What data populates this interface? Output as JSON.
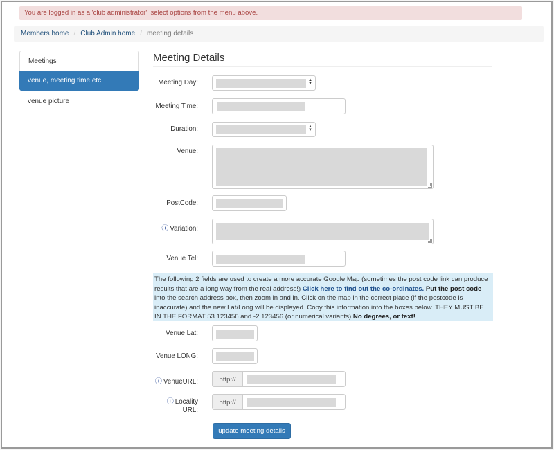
{
  "alert": {
    "text": "You are logged in as a 'club administrator'; select options from the menu above."
  },
  "breadcrumb": {
    "items": [
      "Members home",
      "Club Admin home"
    ],
    "current": "meeting details"
  },
  "sidebar": {
    "items": [
      {
        "label": "Meetings"
      },
      {
        "label": "venue, meeting time etc",
        "active": true
      },
      {
        "label": "venue picture"
      }
    ]
  },
  "page": {
    "title": "Meeting Details"
  },
  "form": {
    "meeting_day_label": "Meeting Day:",
    "meeting_time_label": "Meeting Time:",
    "duration_label": "Duration:",
    "venue_label": "Venue:",
    "postcode_label": "PostCode:",
    "variation_label": "Variation:",
    "venue_tel_label": "Venue Tel:",
    "venue_lat_label": "Venue Lat:",
    "venue_long_label": "Venue LONG:",
    "venue_url_label": "VenueURL:",
    "locality_url_label_1": "Locality",
    "locality_url_label_2": "URL:",
    "url_prefix": "http://",
    "info_icon": "info-circle-icon"
  },
  "info": {
    "part1": "The following 2 fields are used to create a more accurate Google Map (sometimes the post code link can produce results that are a long way from the real address!) ",
    "link": "Click here to find out the co-ordinates.",
    "bold1": " Put the post code",
    "part2": " into the search address box, then zoom in and in. Click on the map in the correct place (if the postcode is inaccurate) and the new Lat/Long will be displayed. Copy this information into the boxes below. THEY MUST BE IN THE FORMAT 53.123456 and -2.123456 (or numerical variants) ",
    "bold2": "No degrees, or text!"
  },
  "submit": {
    "label": "update meeting details"
  },
  "colors": {
    "primary": "#337ab7",
    "alert_bg": "#f2dede",
    "alert_text": "#a94442",
    "info_bg": "#d9edf7"
  }
}
